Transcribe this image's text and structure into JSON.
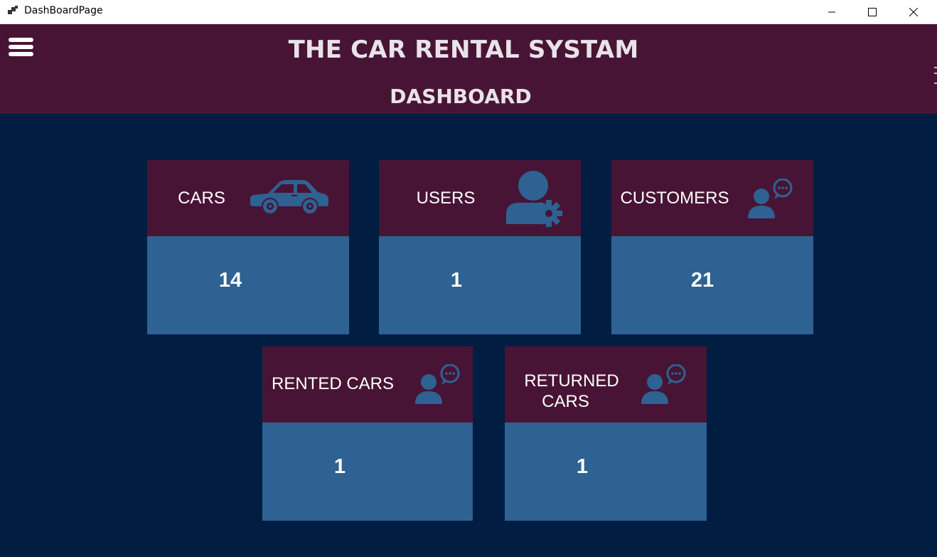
{
  "window": {
    "title": "DashBoardPage",
    "controls": [
      "minimize",
      "maximize",
      "close"
    ]
  },
  "header": {
    "app_title": "THE CAR RENTAL SYSTAM",
    "page_title": "DASHBOARD",
    "menu_icon": "hamburger-menu-icon"
  },
  "colors": {
    "background": "#011d42",
    "header": "#481435",
    "card_head": "#481435",
    "card_body": "#2d6292",
    "icon": "#2d6292",
    "text": "#ffffff"
  },
  "cards": [
    {
      "label": "CARS",
      "value": "14",
      "icon": "car-icon"
    },
    {
      "label": "USERS",
      "value": "1",
      "icon": "user-settings-icon"
    },
    {
      "label": "CUSTOMERS",
      "value": "21",
      "icon": "user-chat-icon"
    },
    {
      "label": "RENTED CARS",
      "value": "1",
      "icon": "user-chat-icon"
    },
    {
      "label_line1": "RETURNED",
      "label_line2": "CARS",
      "value": "1",
      "icon": "user-chat-icon"
    }
  ]
}
